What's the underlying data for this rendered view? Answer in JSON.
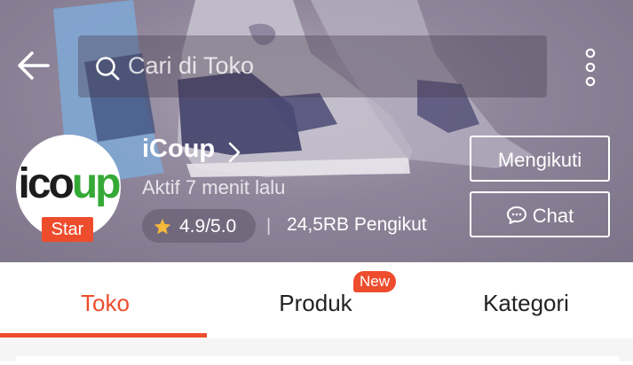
{
  "search": {
    "placeholder": "Cari di Toko"
  },
  "shop": {
    "name": "iCoup",
    "logo_text_left": "ico",
    "logo_text_right": "up",
    "badge": "Star",
    "status": "Aktif 7 menit lalu",
    "rating": "4.9/5.0",
    "separator": "|",
    "followers": "24,5RB Pengikut"
  },
  "actions": {
    "follow_label": "Mengikuti",
    "chat_label": "Chat"
  },
  "tabs": [
    {
      "label": "Toko",
      "active": true
    },
    {
      "label": "Produk",
      "badge": "New"
    },
    {
      "label": "Kategori"
    }
  ],
  "colors": {
    "accent": "#ee4d2d",
    "star": "#f6b93b",
    "logo_green": "#35a936"
  },
  "icons": {
    "back": "arrow-left-icon",
    "search": "search-icon",
    "more": "more-vertical-icon",
    "chevron": "chevron-right-icon",
    "star": "star-icon",
    "chat": "chat-bubble-icon"
  }
}
